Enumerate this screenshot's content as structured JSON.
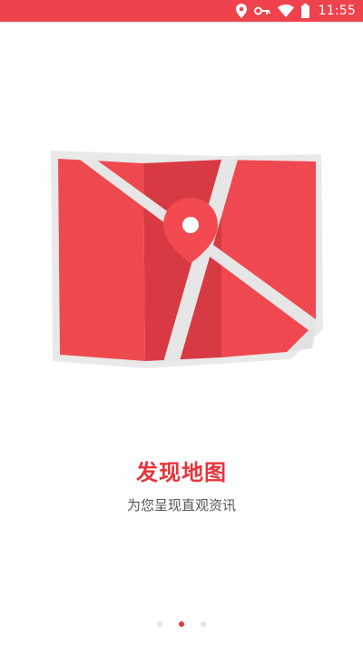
{
  "status_bar": {
    "time": "11:55",
    "background_color": "#f0424c",
    "icons": [
      "location-icon",
      "key-icon",
      "wifi-icon",
      "battery-icon"
    ]
  },
  "onboarding": {
    "illustration": "map-with-location-pin",
    "title": "发现地图",
    "subtitle": "为您呈现直观资讯",
    "title_color": "#e8343c"
  },
  "pager": {
    "pages": 3,
    "active_page": 2,
    "active_color": "#e8343c",
    "inactive_color": "#e3e3e3"
  }
}
